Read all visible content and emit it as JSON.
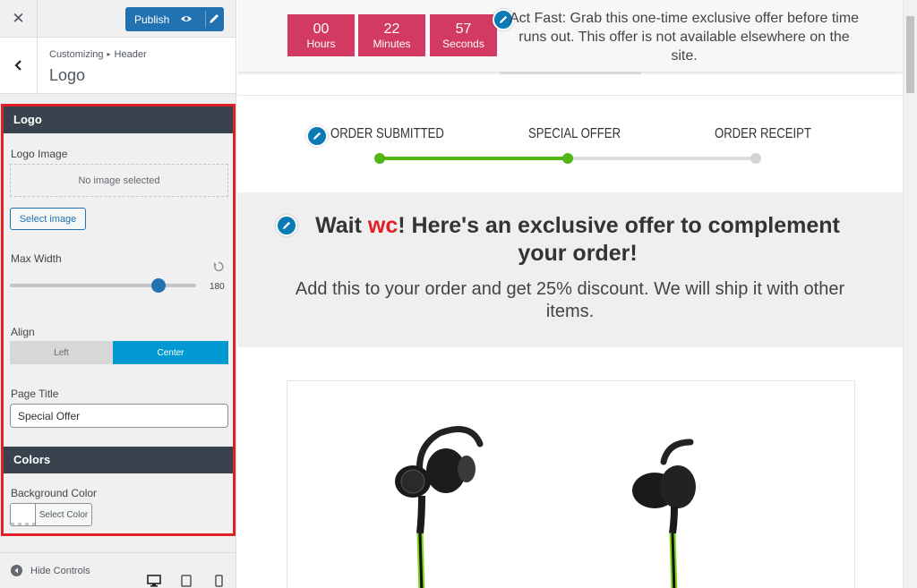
{
  "topbar": {
    "close_icon": "close-icon",
    "publish_label": "Publish"
  },
  "section": {
    "breadcrumb_root": "Customizing",
    "breadcrumb_parent": "Header",
    "title": "Logo"
  },
  "panel": {
    "logo_heading": "Logo",
    "logo_image_label": "Logo Image",
    "no_image_text": "No image selected",
    "select_image_label": "Select image",
    "max_width_label": "Max Width",
    "max_width_value": "180",
    "max_width_fraction": 0.8,
    "align_label": "Align",
    "align_options": [
      "Left",
      "Center"
    ],
    "align_selected": "Center",
    "page_title_label": "Page Title",
    "page_title_value": "Special Offer",
    "colors_heading": "Colors",
    "bg_color_label": "Background Color",
    "select_color_label": "Select Color"
  },
  "footer": {
    "hide_controls_label": "Hide Controls",
    "devices": [
      "desktop-icon",
      "tablet-icon",
      "mobile-icon"
    ]
  },
  "preview": {
    "timer": [
      {
        "num": "00",
        "unit": "Hours"
      },
      {
        "num": "22",
        "unit": "Minutes"
      },
      {
        "num": "57",
        "unit": "Seconds"
      }
    ],
    "offer_text": "Act Fast: Grab this one-time exclusive offer before time runs out. This offer is not available elsewhere on the site.",
    "steps": [
      "ORDER SUBMITTED",
      "SPECIAL OFFER",
      "ORDER RECEIPT"
    ],
    "progress_step": 2,
    "headline_pre": "Wait ",
    "headline_name": "wc",
    "headline_post": "! Here's an exclusive offer to complement your order!",
    "subheadline": "Add this to your order and get 25% discount. We will ship it with other items."
  },
  "colors": {
    "publish_blue": "#2271b1",
    "highlight_red": "#e31e24",
    "panel_head": "#39434e",
    "timer_pink": "#d23a63",
    "progress_green": "#52b614",
    "align_active": "#0099d1",
    "edit_badge": "#0c7bb5"
  }
}
